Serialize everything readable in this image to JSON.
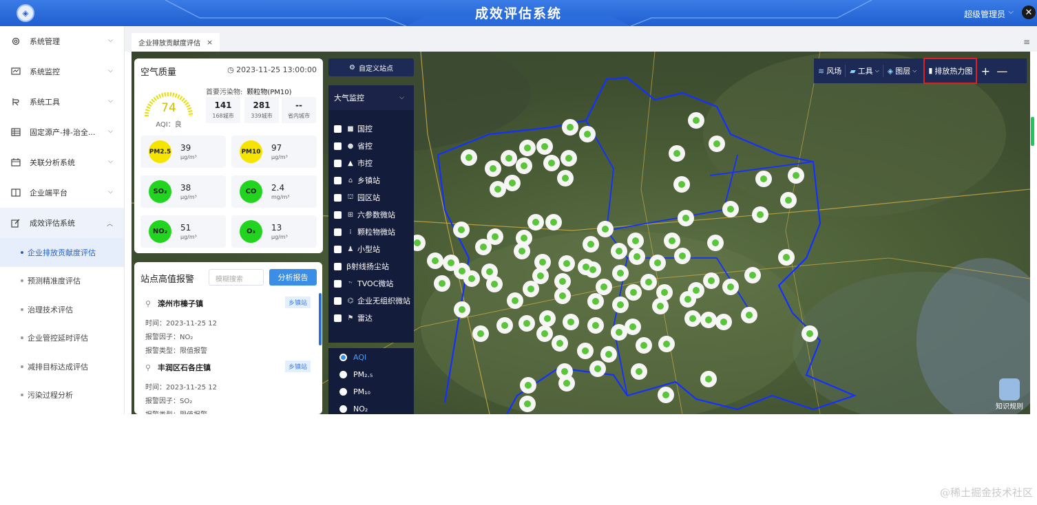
{
  "header": {
    "title": "成效评估系统",
    "user": "超级管理员"
  },
  "sidebar": {
    "items": [
      {
        "label": "系统管理",
        "icon": "gear-icon"
      },
      {
        "label": "系统监控",
        "icon": "monitor-chart-icon"
      },
      {
        "label": "系统工具",
        "icon": "tools-icon"
      },
      {
        "label": "固定源产-排-治全...",
        "icon": "table-icon"
      },
      {
        "label": "关联分析系统",
        "icon": "calendar-icon"
      },
      {
        "label": "企业端平台",
        "icon": "book-icon"
      },
      {
        "label": "成效评估系统",
        "icon": "edit-icon"
      }
    ],
    "sub_items": [
      {
        "label": "企业排放贡献度评估"
      },
      {
        "label": "预测精准度评估"
      },
      {
        "label": "治理技术评估"
      },
      {
        "label": "企业管控延时评估"
      },
      {
        "label": "减排目标达成评估"
      },
      {
        "label": "污染过程分析"
      }
    ]
  },
  "tabs": [
    {
      "label": "企业排放贡献度评估"
    }
  ],
  "air_quality": {
    "title": "空气质量",
    "time": "2023-11-25 13:00:00",
    "aqi_value": "74",
    "aqi_label": "AQI：良",
    "aqi_fraction": 0.37,
    "primary_label": "首要污染物:",
    "primary_value": "颗粒物(PM10)",
    "stats": [
      {
        "num": "141",
        "cap": "168城市"
      },
      {
        "num": "281",
        "cap": "339城市"
      },
      {
        "num": "--",
        "cap": "省内城市"
      }
    ],
    "pollutants": [
      {
        "name": "PM2.5",
        "value": "39",
        "unit": "μg/m³",
        "color": "#f5e400"
      },
      {
        "name": "PM10",
        "value": "97",
        "unit": "μg/m³",
        "color": "#f5e400"
      },
      {
        "name": "SO₂",
        "value": "38",
        "unit": "μg/m³",
        "color": "#22d31f"
      },
      {
        "name": "CO",
        "value": "2.4",
        "unit": "mg/m³",
        "color": "#22d31f"
      },
      {
        "name": "NO₂",
        "value": "51",
        "unit": "μg/m³",
        "color": "#22d31f"
      },
      {
        "name": "O₃",
        "value": "13",
        "unit": "μg/m³",
        "color": "#22d31f"
      }
    ]
  },
  "alarm": {
    "title": "站点高值报警",
    "search_placeholder": "模糊搜索",
    "report_button": "分析报告",
    "items": [
      {
        "name": "滦州市榛子镇",
        "tag": "乡镇站",
        "time": "时间：2023-11-25 12",
        "factor": "报警因子：NO₂",
        "type": "报警类型：限值报警"
      },
      {
        "name": "丰润区石各庄镇",
        "tag": "乡镇站",
        "time": "时间：2023-11-25 12",
        "factor": "报警因子：SO₂",
        "type": "报警类型：限值报警"
      }
    ]
  },
  "map_controls": {
    "custom_station": "自定义站点",
    "monitor_title": "大气监控",
    "stations": [
      {
        "label": "国控",
        "icon": "square-icon"
      },
      {
        "label": "省控",
        "icon": "circle-icon"
      },
      {
        "label": "市控",
        "icon": "triangle-icon"
      },
      {
        "label": "乡镇站",
        "icon": "town-icon"
      },
      {
        "label": "园区站",
        "icon": "park-icon"
      },
      {
        "label": "六参数微站",
        "icon": "six-param-icon"
      },
      {
        "label": "颗粒物微站",
        "icon": "particle-icon"
      },
      {
        "label": "小型站",
        "icon": "small-station-icon"
      },
      {
        "label": "β射线扬尘站",
        "icon": "beta-ray-icon"
      },
      {
        "label": "TVOC微站",
        "icon": "tvoc-icon"
      },
      {
        "label": "企业无组织微站",
        "icon": "factory-icon"
      },
      {
        "label": "雷达",
        "icon": "radar-icon"
      }
    ],
    "indices": [
      {
        "label": "AQI",
        "selected": true
      },
      {
        "label": "PM₂.₅",
        "selected": false
      },
      {
        "label": "PM₁₀",
        "selected": false
      },
      {
        "label": "NO₂",
        "selected": false
      }
    ],
    "toolbar": {
      "wind": "风场",
      "tools": "工具",
      "layers": "图层",
      "heatmap": "排放热力图"
    },
    "kb_label": "知识规则"
  },
  "watermark": "@稀土掘金技术社区",
  "colors": {
    "header": "#2563d8",
    "accent": "#3a8ee6",
    "dark_panel": "#141c3c",
    "boundary": "#1430ff",
    "highlight_border": "#e02020"
  }
}
